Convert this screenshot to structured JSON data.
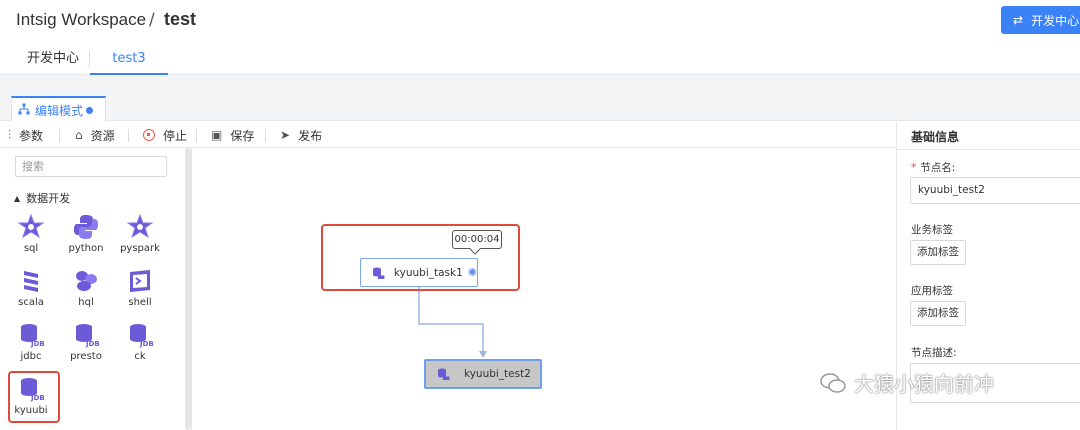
{
  "header": {
    "workspace": "Intsig Workspace",
    "separator": "/",
    "project": "test",
    "dev_center_button": "开发中心"
  },
  "tabs": [
    {
      "label": "开发中心",
      "active": false
    },
    {
      "label": "test3",
      "active": true
    }
  ],
  "edit_mode": {
    "label": "编辑模式"
  },
  "toolbar": {
    "params": "参数",
    "resources": "资源",
    "stop": "停止",
    "save": "保存",
    "publish": "发布"
  },
  "left_panel": {
    "search_placeholder": "搜索",
    "group_title": "数据开发",
    "node_types": [
      {
        "label": "sql",
        "icon": "star-icon"
      },
      {
        "label": "python",
        "icon": "python-icon"
      },
      {
        "label": "pyspark",
        "icon": "star-icon"
      },
      {
        "label": "scala",
        "icon": "scala-icon"
      },
      {
        "label": "hql",
        "icon": "hql-icon"
      },
      {
        "label": "shell",
        "icon": "shell-icon"
      },
      {
        "label": "jdbc",
        "icon": "jdbc-database-icon"
      },
      {
        "label": "presto",
        "icon": "jdbc-database-icon"
      },
      {
        "label": "ck",
        "icon": "jdbc-database-icon"
      },
      {
        "label": "kyuubi",
        "icon": "jdbc-database-icon"
      }
    ],
    "jdbc_icon_text": "JDBC"
  },
  "canvas": {
    "timer": "00:00:04",
    "task1": "kyuubi_task1",
    "task2": "kyuubi_test2"
  },
  "right_panel": {
    "title": "基础信息",
    "node_name_label": "节点名:",
    "required_mark": "*",
    "node_name_value": "kyuubi_test2",
    "business_tag_label": "业务标签",
    "add_tag_button": "添加标签",
    "app_tag_label": "应用标签",
    "add_app_tag_button": "添加标签",
    "description_label": "节点描述:"
  },
  "watermark": {
    "text": "大猿小猿向前冲"
  },
  "colors": {
    "accent": "#3b82f6",
    "highlight": "#e04a3a",
    "icon_purple": "#6b5bd6"
  }
}
